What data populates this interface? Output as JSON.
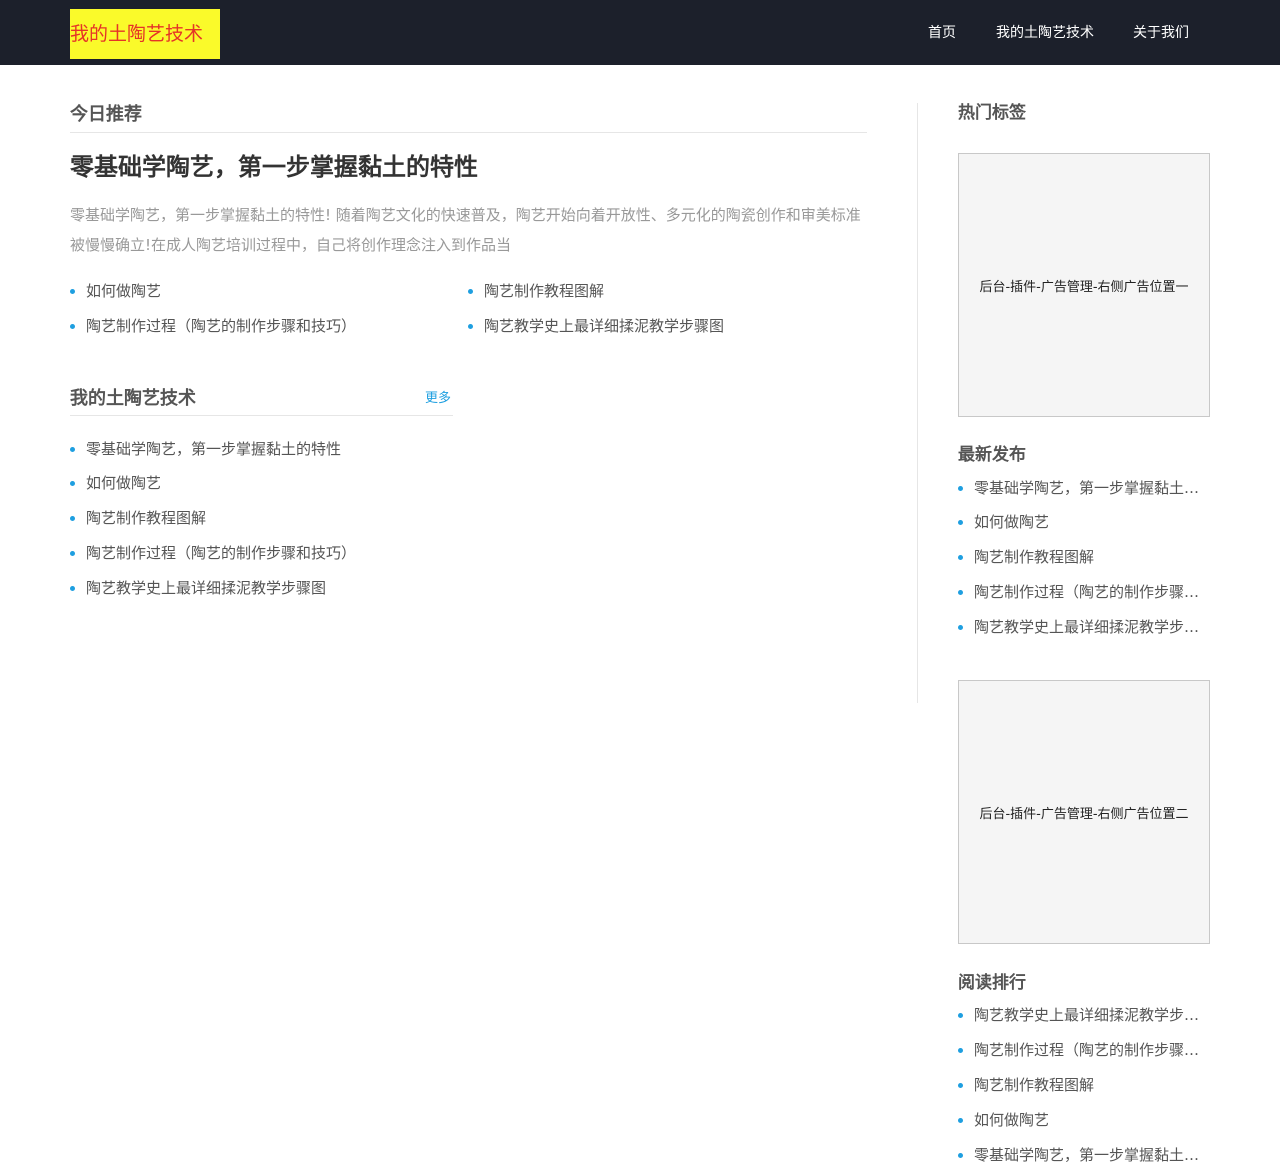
{
  "header": {
    "logo_text": "我的土陶艺技术",
    "nav": [
      "首页",
      "我的土陶艺技术",
      "关于我们"
    ]
  },
  "recommend": {
    "section_title": "今日推荐",
    "article_title": "零基础学陶艺，第一步掌握黏土的特性",
    "summary": "零基础学陶艺，第一步掌握黏土的特性! 随着陶艺文化的快速普及，陶艺开始向着开放性、多元化的陶瓷创作和审美标准被慢慢确立!在成人陶艺培训过程中，自己将创作理念注入到作品当",
    "links": [
      "如何做陶艺",
      "陶艺制作教程图解",
      "陶艺制作过程（陶艺的制作步骤和技巧）",
      "陶艺教学史上最详细揉泥教学步骤图"
    ]
  },
  "category": {
    "section_title": "我的土陶艺技术",
    "more_label": "更多",
    "links": [
      "零基础学陶艺，第一步掌握黏土的特性",
      "如何做陶艺",
      "陶艺制作教程图解",
      "陶艺制作过程（陶艺的制作步骤和技巧）",
      "陶艺教学史上最详细揉泥教学步骤图"
    ]
  },
  "sidebar": {
    "hot_tags_title": "热门标签",
    "ad1_text": "后台-插件-广告管理-右侧广告位置一",
    "latest_title": "最新发布",
    "latest": [
      "零基础学陶艺，第一步掌握黏土的特性",
      "如何做陶艺",
      "陶艺制作教程图解",
      "陶艺制作过程（陶艺的制作步骤和技巧）",
      "陶艺教学史上最详细揉泥教学步骤图"
    ],
    "ad2_text": "后台-插件-广告管理-右侧广告位置二",
    "ranking_title": "阅读排行",
    "ranking": [
      "陶艺教学史上最详细揉泥教学步骤图",
      "陶艺制作过程（陶艺的制作步骤和技巧）",
      "陶艺制作教程图解",
      "如何做陶艺",
      "零基础学陶艺，第一步掌握黏土的特性"
    ]
  },
  "colors": {
    "header_bg": "#1c202b",
    "logo_bg": "#fafa2a",
    "logo_text": "#e53427",
    "accent": "#1e9fe0"
  }
}
